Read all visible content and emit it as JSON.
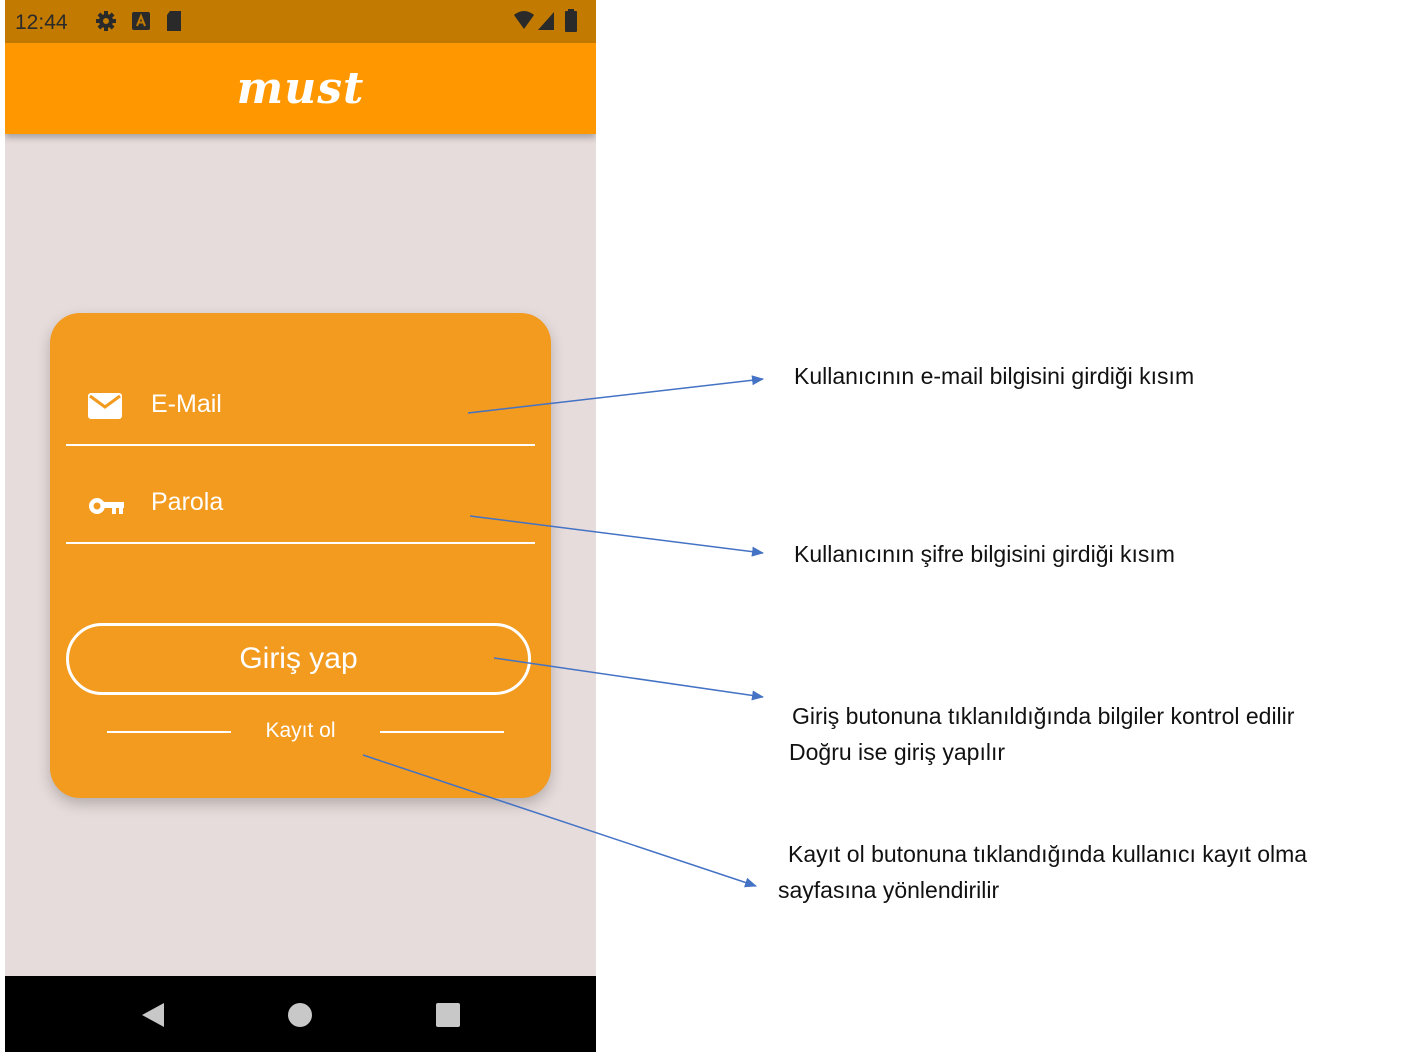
{
  "status_bar": {
    "time": "12:44",
    "icons": [
      "gear-icon",
      "a-icon",
      "sd-card-icon"
    ],
    "right_icons": [
      "wifi-icon",
      "signal-icon",
      "battery-icon"
    ]
  },
  "app_bar": {
    "title": "must"
  },
  "login_card": {
    "email_placeholder": "E-Mail",
    "email_icon": "mail-icon",
    "password_placeholder": "Parola",
    "password_icon": "key-icon",
    "login_button": "Giriş yap",
    "register_link": "Kayıt ol"
  },
  "nav_bar": {
    "buttons": [
      "back-icon",
      "home-icon",
      "recents-icon"
    ]
  },
  "annotations": {
    "email": "Kullanıcının e-mail bilgisini girdiği kısım",
    "password": "Kullanıcının şifre bilgisini girdiği kısım",
    "login_line1": "Giriş  butonuna tıklanıldığında bilgiler kontrol edilir",
    "login_line2": "Doğru ise giriş yapılır",
    "register_line1": "Kayıt ol butonuna tıklandığında kullanıcı kayıt olma",
    "register_line2": "sayfasına yönlendirilir"
  },
  "colors": {
    "status_bar": "#c27a00",
    "app_bar": "#ff9800",
    "card": "#f29b1f",
    "background": "#e6dcdb",
    "arrow": "#4472c4"
  }
}
